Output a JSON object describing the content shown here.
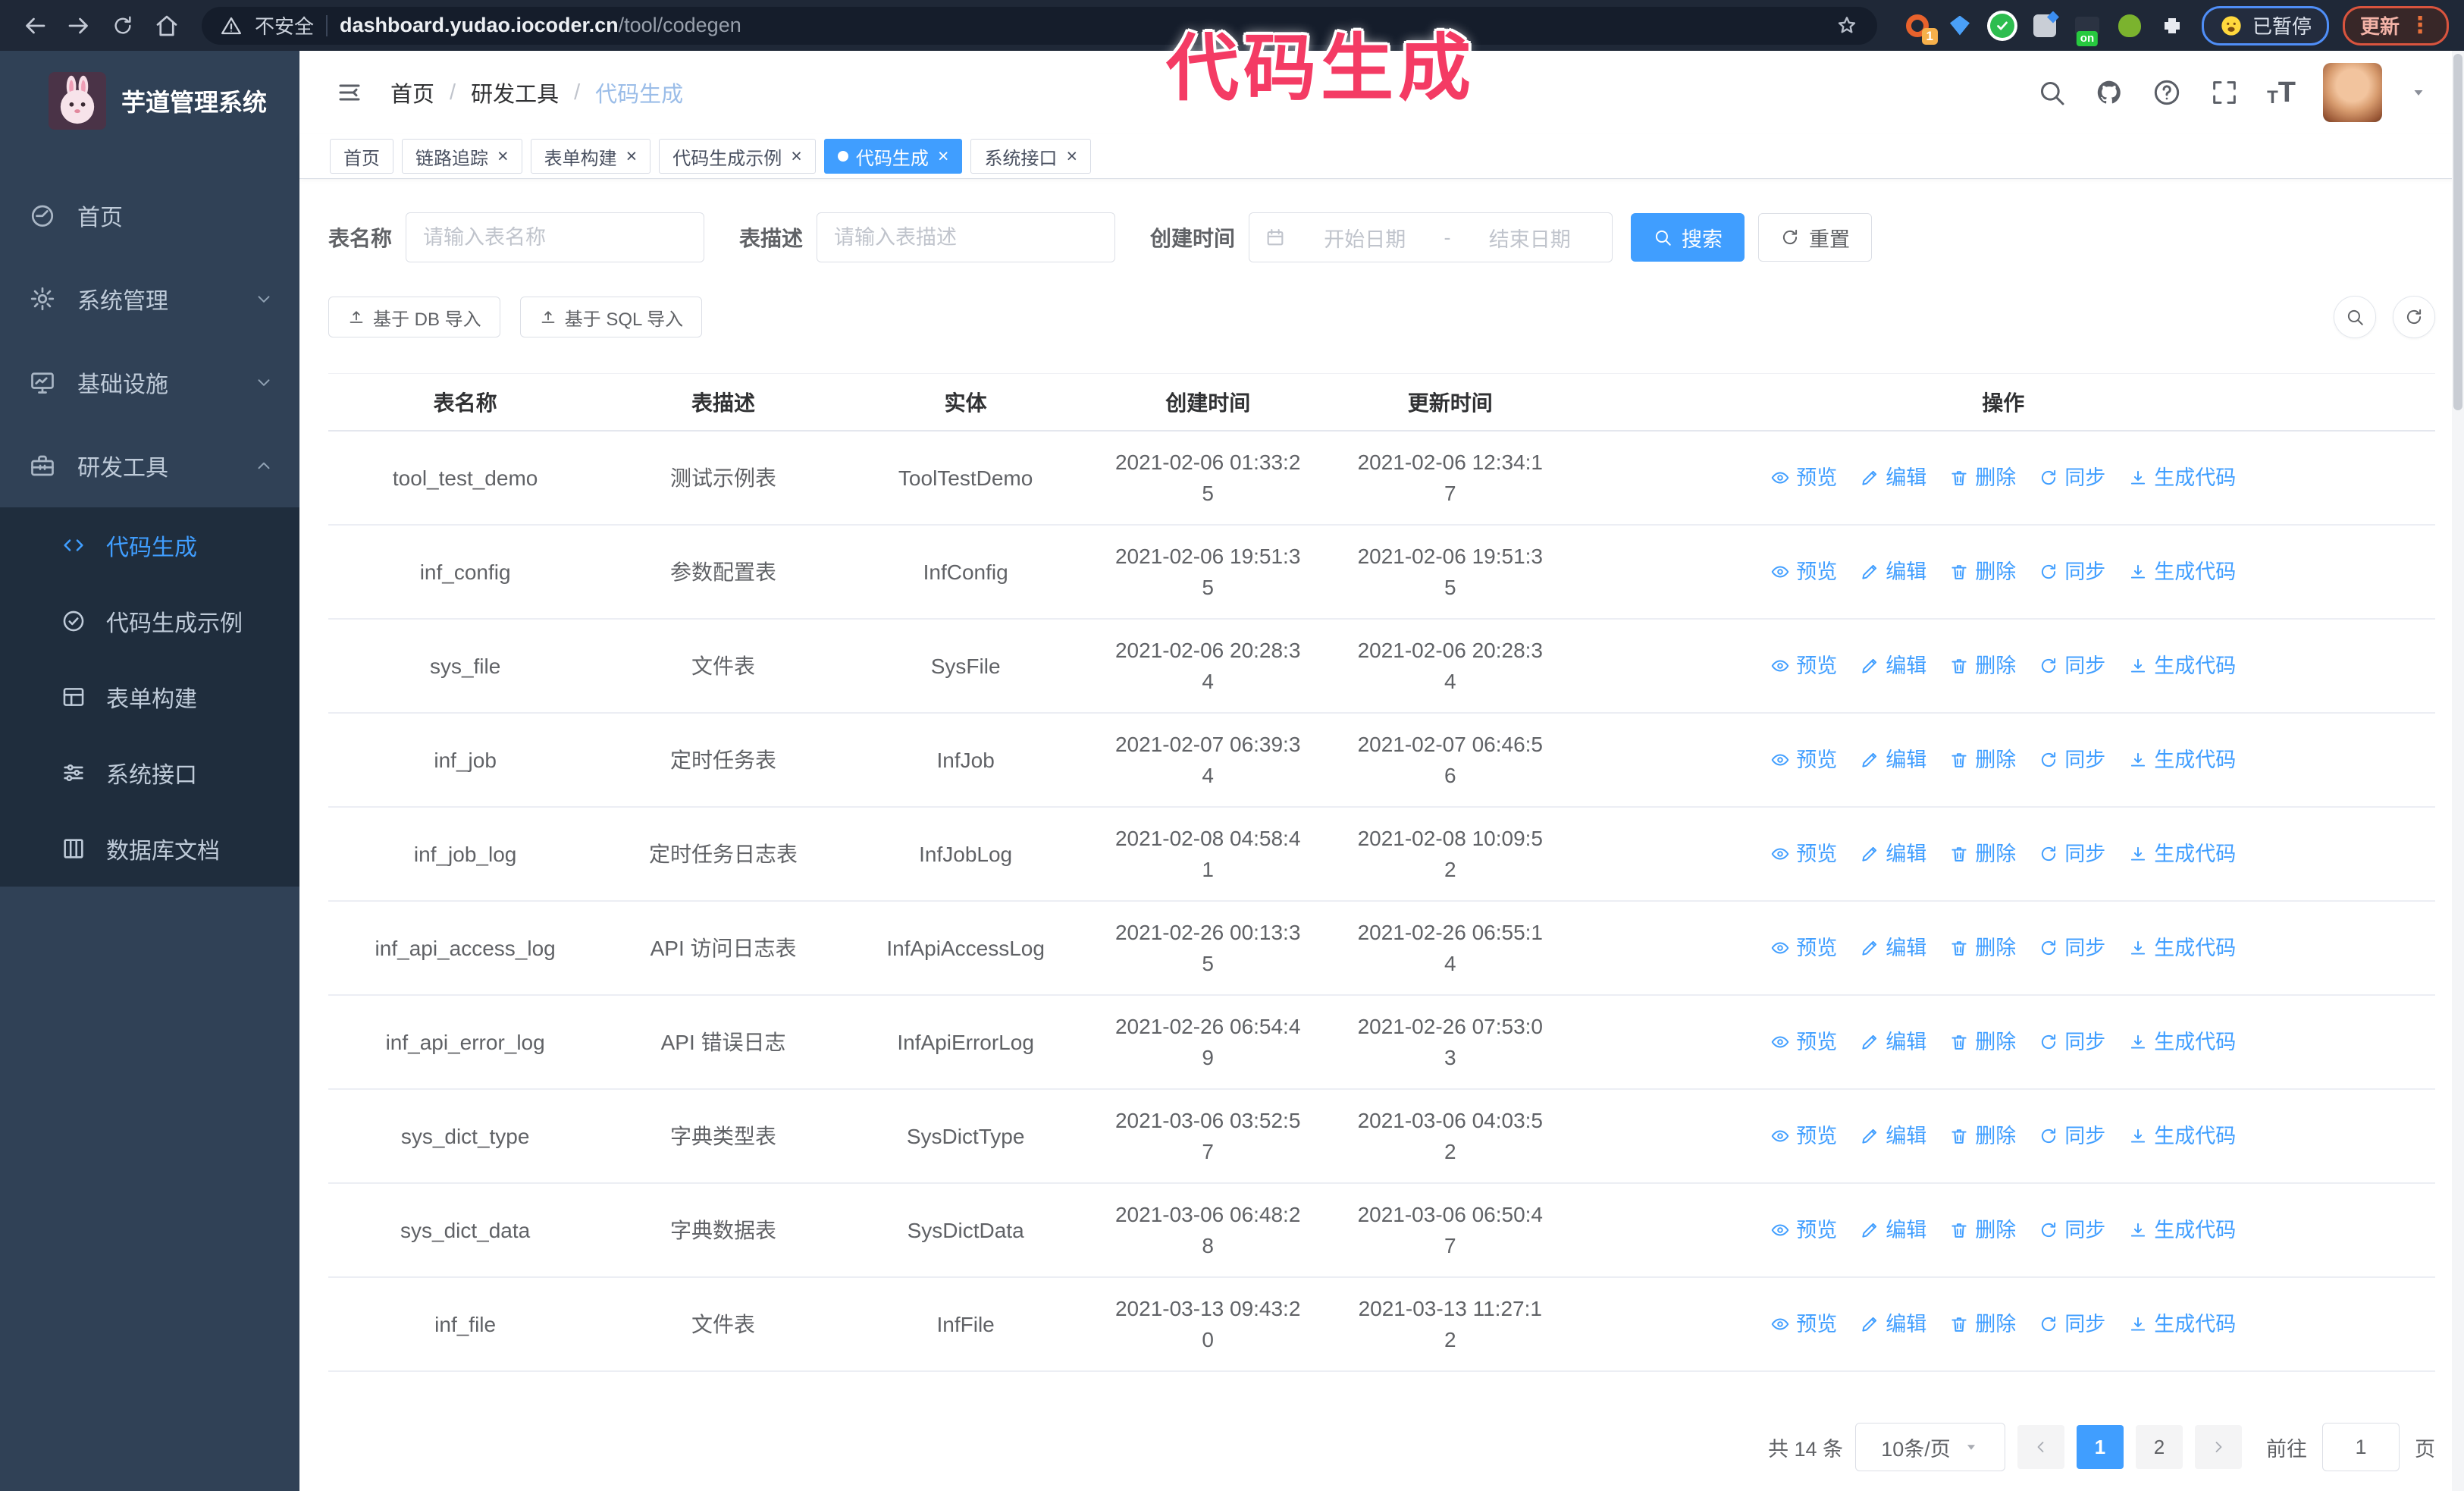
{
  "browser": {
    "security_label": "不安全",
    "url_host": "dashboard.yudao.iocoder.cn",
    "url_path": "/tool/codegen",
    "extensions": {
      "badge_count": "1",
      "on_badge": "on"
    },
    "paused_badge": "已暂停",
    "update_button": "更新"
  },
  "overlay_title": "代码生成",
  "sidebar": {
    "app_title": "芋道管理系统",
    "items": [
      {
        "id": "home",
        "label": "首页",
        "icon": "dashboard",
        "expandable": false,
        "expanded": false,
        "active": false
      },
      {
        "id": "system",
        "label": "系统管理",
        "icon": "gear",
        "expandable": true,
        "expanded": false,
        "active": false
      },
      {
        "id": "infra",
        "label": "基础设施",
        "icon": "monitor",
        "expandable": true,
        "expanded": false,
        "active": false
      },
      {
        "id": "devtools",
        "label": "研发工具",
        "icon": "toolbox",
        "expandable": true,
        "expanded": true,
        "active": false
      }
    ],
    "submenu": [
      {
        "id": "codegen",
        "label": "代码生成",
        "icon": "code",
        "active": true
      },
      {
        "id": "codegen-example",
        "label": "代码生成示例",
        "icon": "example",
        "active": false
      },
      {
        "id": "form-build",
        "label": "表单构建",
        "icon": "form",
        "active": false
      },
      {
        "id": "system-api",
        "label": "系统接口",
        "icon": "sliders",
        "active": false
      },
      {
        "id": "db-doc",
        "label": "数据库文档",
        "icon": "database",
        "active": false
      }
    ]
  },
  "header": {
    "breadcrumb": [
      "首页",
      "研发工具",
      "代码生成"
    ]
  },
  "tabs": [
    {
      "id": "home",
      "label": "首页",
      "closable": false,
      "active": false
    },
    {
      "id": "tracing",
      "label": "链路追踪",
      "closable": true,
      "active": false
    },
    {
      "id": "form-build",
      "label": "表单构建",
      "closable": true,
      "active": false
    },
    {
      "id": "codegen-example",
      "label": "代码生成示例",
      "closable": true,
      "active": false
    },
    {
      "id": "codegen",
      "label": "代码生成",
      "closable": true,
      "active": true
    },
    {
      "id": "system-api",
      "label": "系统接口",
      "closable": true,
      "active": false
    }
  ],
  "filters": {
    "table_name_label": "表名称",
    "table_name_placeholder": "请输入表名称",
    "table_desc_label": "表描述",
    "table_desc_placeholder": "请输入表描述",
    "create_time_label": "创建时间",
    "start_date_placeholder": "开始日期",
    "range_separator": "-",
    "end_date_placeholder": "结束日期",
    "search_label": "搜索",
    "reset_label": "重置"
  },
  "toolbar": {
    "import_db_label": "基于 DB 导入",
    "import_sql_label": "基于 SQL 导入"
  },
  "table": {
    "columns": [
      "表名称",
      "表描述",
      "实体",
      "创建时间",
      "更新时间",
      "操作"
    ],
    "actions": [
      "预览",
      "编辑",
      "删除",
      "同步",
      "生成代码"
    ],
    "rows": [
      {
        "name": "tool_test_demo",
        "desc": "测试示例表",
        "entity": "ToolTestDemo",
        "created": "2021-02-06 01:33:25",
        "updated": "2021-02-06 12:34:17"
      },
      {
        "name": "inf_config",
        "desc": "参数配置表",
        "entity": "InfConfig",
        "created": "2021-02-06 19:51:35",
        "updated": "2021-02-06 19:51:35"
      },
      {
        "name": "sys_file",
        "desc": "文件表",
        "entity": "SysFile",
        "created": "2021-02-06 20:28:34",
        "updated": "2021-02-06 20:28:34"
      },
      {
        "name": "inf_job",
        "desc": "定时任务表",
        "entity": "InfJob",
        "created": "2021-02-07 06:39:34",
        "updated": "2021-02-07 06:46:56"
      },
      {
        "name": "inf_job_log",
        "desc": "定时任务日志表",
        "entity": "InfJobLog",
        "created": "2021-02-08 04:58:41",
        "updated": "2021-02-08 10:09:52"
      },
      {
        "name": "inf_api_access_log",
        "desc": "API 访问日志表",
        "entity": "InfApiAccessLog",
        "created": "2021-02-26 00:13:35",
        "updated": "2021-02-26 06:55:14"
      },
      {
        "name": "inf_api_error_log",
        "desc": "API 错误日志",
        "entity": "InfApiErrorLog",
        "created": "2021-02-26 06:54:49",
        "updated": "2021-02-26 07:53:03"
      },
      {
        "name": "sys_dict_type",
        "desc": "字典类型表",
        "entity": "SysDictType",
        "created": "2021-03-06 03:52:57",
        "updated": "2021-03-06 04:03:52"
      },
      {
        "name": "sys_dict_data",
        "desc": "字典数据表",
        "entity": "SysDictData",
        "created": "2021-03-06 06:48:28",
        "updated": "2021-03-06 06:50:47"
      },
      {
        "name": "inf_file",
        "desc": "文件表",
        "entity": "InfFile",
        "created": "2021-03-13 09:43:20",
        "updated": "2021-03-13 11:27:12"
      }
    ]
  },
  "pagination": {
    "total_label": "共 14 条",
    "page_size_label": "10条/页",
    "pages": [
      "1",
      "2"
    ],
    "active_page": "1",
    "goto_label": "前往",
    "goto_value": "1",
    "goto_suffix": "页"
  },
  "colors": {
    "primary": "#409eff",
    "overlay_pink": "#f43b64",
    "sidebar_bg": "#304156",
    "submenu_bg": "#1f2d3d",
    "chrome_bg": "#1f2837"
  }
}
